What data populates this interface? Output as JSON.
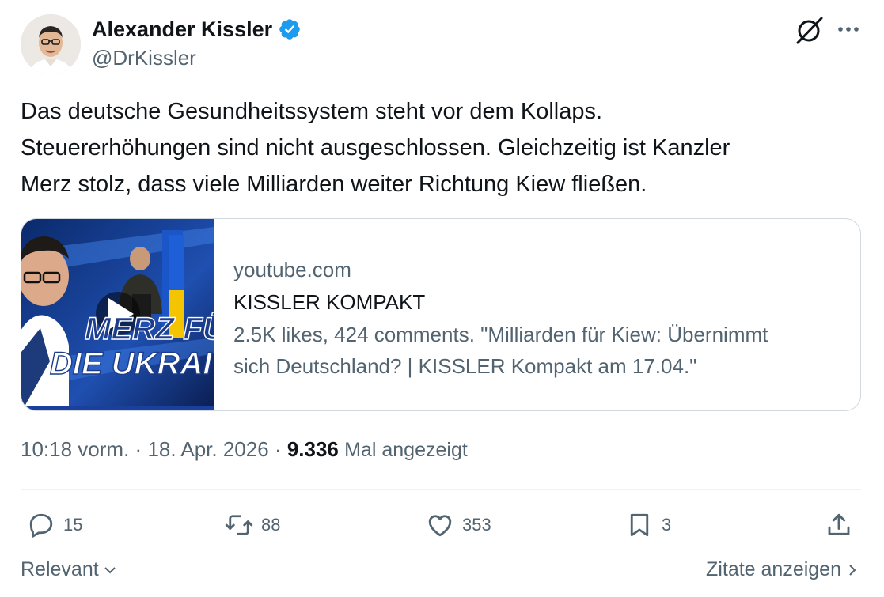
{
  "author": {
    "name": "Alexander Kissler",
    "handle": "@DrKissler"
  },
  "tweet": {
    "lines": [
      "Das deutsche Gesundheitssystem steht vor dem Kollaps.",
      "Steuererhöhungen sind nicht ausgeschlossen. Gleichzeitig ist Kanzler",
      "Merz stolz, dass viele Milliarden weiter Richtung Kiew fließen."
    ]
  },
  "card": {
    "domain": "youtube.com",
    "title": "KISSLER KOMPAKT",
    "description_lines": [
      "2.5K likes, 424 comments. \"Milliarden für Kiew: Übernimmt",
      "sich Deutschland? | KISSLER Kompakt am 17.04.\""
    ],
    "thumbnail_text_line1": "MERZ FÜ",
    "thumbnail_text_line2": "DIE UKRAI"
  },
  "meta": {
    "time": "10:18 vorm.",
    "separator": "·",
    "date": "18. Apr. 2026",
    "views_count": "9.336",
    "views_label": "Mal angezeigt"
  },
  "actions": {
    "replies": "15",
    "reposts": "88",
    "likes": "353",
    "bookmarks": "3"
  },
  "footer": {
    "sort_label": "Relevant",
    "quotes_label": "Zitate anzeigen"
  },
  "icons": [
    "verified-badge-icon",
    "grok-icon",
    "more-icon",
    "reply-icon",
    "repost-icon",
    "like-icon",
    "bookmark-icon",
    "share-icon",
    "play-icon",
    "chevron-down-icon",
    "chevron-right-icon"
  ],
  "colors": {
    "text": "#0f1419",
    "secondary": "#536471",
    "verified": "#1d9bf0",
    "border": "#cfd9de"
  }
}
